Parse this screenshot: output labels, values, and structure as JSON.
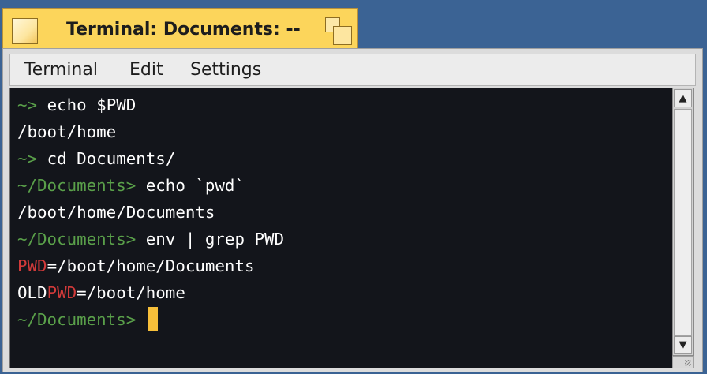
{
  "window": {
    "title": "Terminal: Documents: --"
  },
  "menubar": {
    "items": [
      "Terminal",
      "Edit",
      "Settings"
    ]
  },
  "terminal": {
    "lines": [
      [
        {
          "text": "~>",
          "color": "green"
        },
        {
          "text": " echo $PWD",
          "color": "white"
        }
      ],
      [
        {
          "text": "/boot/home",
          "color": "white"
        }
      ],
      [
        {
          "text": "~>",
          "color": "green"
        },
        {
          "text": " cd Documents/",
          "color": "white"
        }
      ],
      [
        {
          "text": "~/Documents>",
          "color": "green"
        },
        {
          "text": " echo `pwd`",
          "color": "white"
        }
      ],
      [
        {
          "text": "/boot/home/Documents",
          "color": "white"
        }
      ],
      [
        {
          "text": "~/Documents>",
          "color": "green"
        },
        {
          "text": " env | grep PWD",
          "color": "white"
        }
      ],
      [
        {
          "text": "PWD",
          "color": "red"
        },
        {
          "text": "=/boot/home/Documents",
          "color": "white"
        }
      ],
      [
        {
          "text": "OLD",
          "color": "white"
        },
        {
          "text": "PWD",
          "color": "red"
        },
        {
          "text": "=/boot/home",
          "color": "white"
        }
      ],
      [
        {
          "text": "~/Documents>",
          "color": "green"
        },
        {
          "text": " ",
          "color": "white"
        }
      ]
    ],
    "colors": {
      "background": "#13151b",
      "prompt": "#5aa04a",
      "highlight": "#d23a3a",
      "text": "#ffffff",
      "cursor": "#f7bf3a"
    }
  },
  "scrollbar": {
    "up_icon": "triangle-up-icon",
    "down_icon": "triangle-down-icon"
  },
  "theme": {
    "tab_color": "#fcd55b",
    "desktop_color": "#3b6394"
  }
}
